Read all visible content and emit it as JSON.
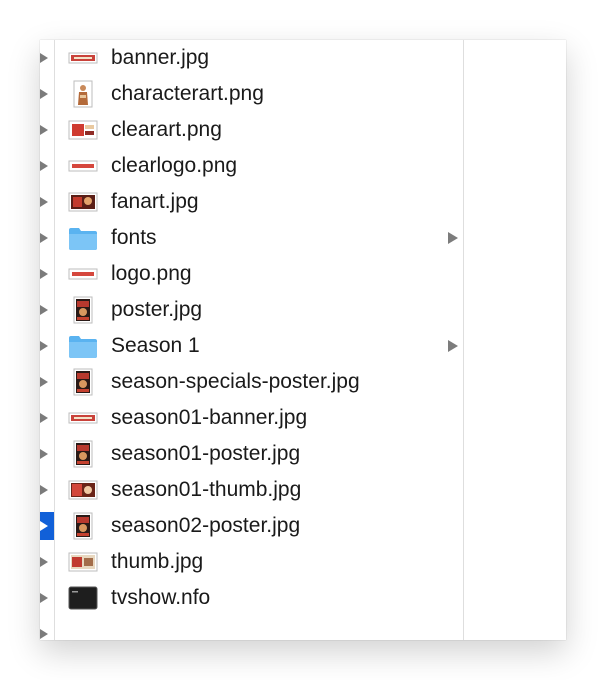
{
  "window": {
    "accent_color": "#1160d8",
    "folder_color": "#5ab3f0"
  },
  "files": [
    {
      "name": "banner.jpg",
      "icon": "banner-image-icon",
      "kind": "banner"
    },
    {
      "name": "characterart.png",
      "icon": "character-image-icon",
      "kind": "character"
    },
    {
      "name": "clearart.png",
      "icon": "clearart-image-icon",
      "kind": "clearart"
    },
    {
      "name": "clearlogo.png",
      "icon": "logo-image-icon",
      "kind": "logo"
    },
    {
      "name": "fanart.jpg",
      "icon": "fanart-image-icon",
      "kind": "fanart"
    },
    {
      "name": "fonts",
      "icon": "folder-icon",
      "kind": "folder",
      "has_children": true
    },
    {
      "name": "logo.png",
      "icon": "logo-image-icon",
      "kind": "logo"
    },
    {
      "name": "poster.jpg",
      "icon": "poster-image-icon",
      "kind": "poster"
    },
    {
      "name": "Season 1",
      "icon": "folder-icon",
      "kind": "folder",
      "has_children": true
    },
    {
      "name": "season-specials-poster.jpg",
      "icon": "poster-image-icon",
      "kind": "poster"
    },
    {
      "name": "season01-banner.jpg",
      "icon": "banner-image-icon",
      "kind": "banner"
    },
    {
      "name": "season01-poster.jpg",
      "icon": "poster-image-icon",
      "kind": "poster"
    },
    {
      "name": "season01-thumb.jpg",
      "icon": "thumb-image-icon",
      "kind": "thumb"
    },
    {
      "name": "season02-poster.jpg",
      "icon": "poster-image-icon",
      "kind": "poster"
    },
    {
      "name": "thumb.jpg",
      "icon": "thumb-image-icon",
      "kind": "thumb2"
    },
    {
      "name": "tvshow.nfo",
      "icon": "nfo-document-icon",
      "kind": "nfo"
    }
  ],
  "previous_column": {
    "selected_index": 13
  }
}
